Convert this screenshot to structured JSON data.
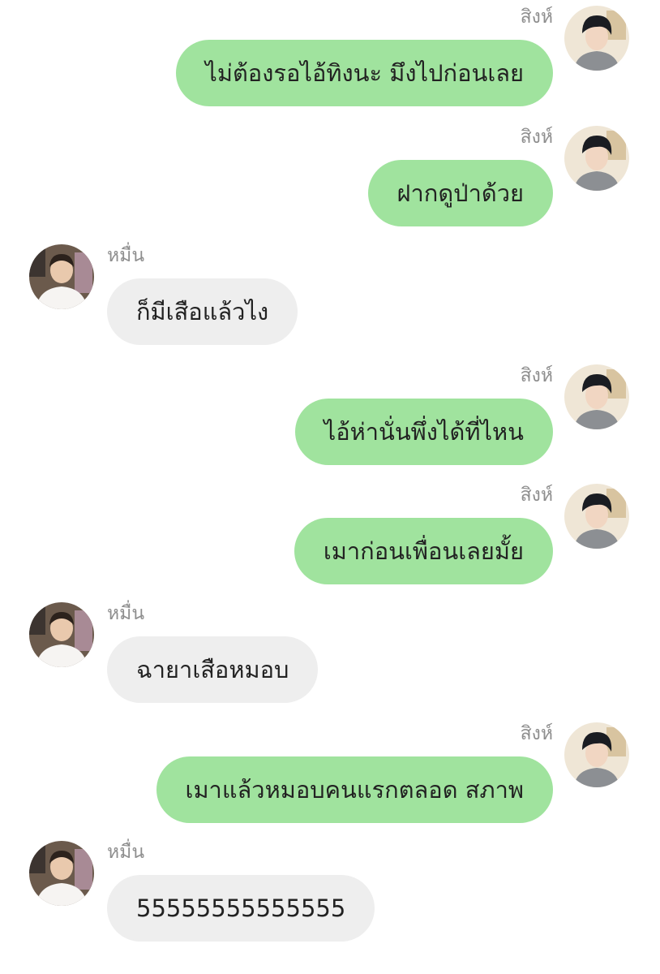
{
  "theme": {
    "outgoing_bubble_color": "#a0e39e",
    "incoming_bubble_color": "#eeeeee",
    "name_color": "#8e8e8e",
    "background": "#ffffff"
  },
  "messages": [
    {
      "side": "right",
      "sender": "สิงห์",
      "text": "ไม่ต้องรอไอ้ทิงนะ มึงไปก่อนเลย",
      "avatar_icon": "user-avatar-photo"
    },
    {
      "side": "right",
      "sender": "สิงห์",
      "text": "ฝากดูป่าด้วย",
      "avatar_icon": "user-avatar-photo"
    },
    {
      "side": "left",
      "sender": "หมื่น",
      "text": "ก็มีเสือแล้วไง",
      "avatar_icon": "user-avatar-photo"
    },
    {
      "side": "right",
      "sender": "สิงห์",
      "text": "ไอ้ห่านั่นพึ่งได้ที่ไหน",
      "avatar_icon": "user-avatar-photo"
    },
    {
      "side": "right",
      "sender": "สิงห์",
      "text": "เมาก่อนเพื่อนเลยมั้ย",
      "avatar_icon": "user-avatar-photo"
    },
    {
      "side": "left",
      "sender": "หมื่น",
      "text": "ฉายาเสือหมอบ",
      "avatar_icon": "user-avatar-photo"
    },
    {
      "side": "right",
      "sender": "สิงห์",
      "text": "เมาแล้วหมอบคนแรกตลอด สภาพ",
      "avatar_icon": "user-avatar-photo"
    },
    {
      "side": "left",
      "sender": "หมื่น",
      "text": "55555555555555",
      "avatar_icon": "user-avatar-photo"
    }
  ]
}
